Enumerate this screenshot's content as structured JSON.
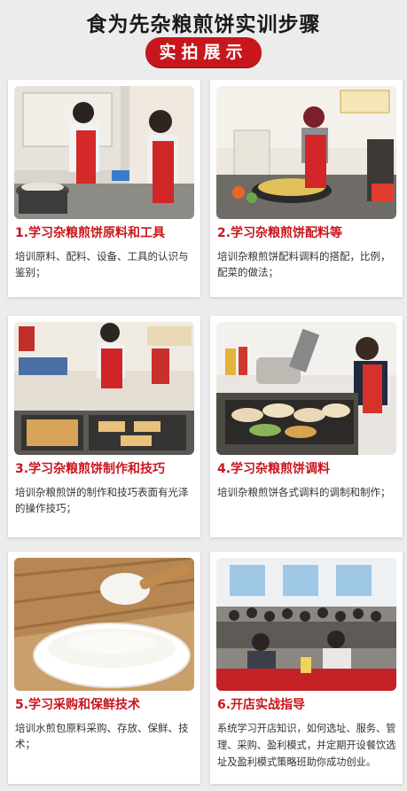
{
  "header": {
    "title": "食为先杂粮煎饼实训步骤",
    "badge": "实拍展示"
  },
  "cards": [
    {
      "title": "1.学习杂粮煎饼原料和工具",
      "desc": "培训原料、配料、设备、工具的认识与鉴别；",
      "photo_icon": "training-kitchen-photo"
    },
    {
      "title": "2.学习杂粮煎饼配料等",
      "desc": "培训杂粮煎饼配料调料的搭配，比例，配菜的做法；",
      "photo_icon": "cooking-pancake-photo"
    },
    {
      "title": "3.学习杂粮煎饼制作和技巧",
      "desc": "培训杂粮煎饼的制作和技巧表面有光泽的操作技巧；",
      "photo_icon": "pancake-tray-photo"
    },
    {
      "title": "4.学习杂粮煎饼调料",
      "desc": "培训杂粮煎饼各式调料的调制和制作；",
      "photo_icon": "seasoning-display-photo"
    },
    {
      "title": "5.学习采购和保鲜技术",
      "desc": "培训水煎包原料采购、存放、保鲜、技术；",
      "photo_icon": "flour-bowl-photo"
    },
    {
      "title": "6.开店实战指导",
      "desc": "系统学习开店知识，如何选址、服务、管理、采购、盈利模式，并定期开设餐饮选址及盈利模式策略班助你成功创业。",
      "photo_icon": "classroom-photo"
    }
  ],
  "colors": {
    "accent": "#c8161d",
    "background": "#ececec",
    "card": "#ffffff"
  }
}
